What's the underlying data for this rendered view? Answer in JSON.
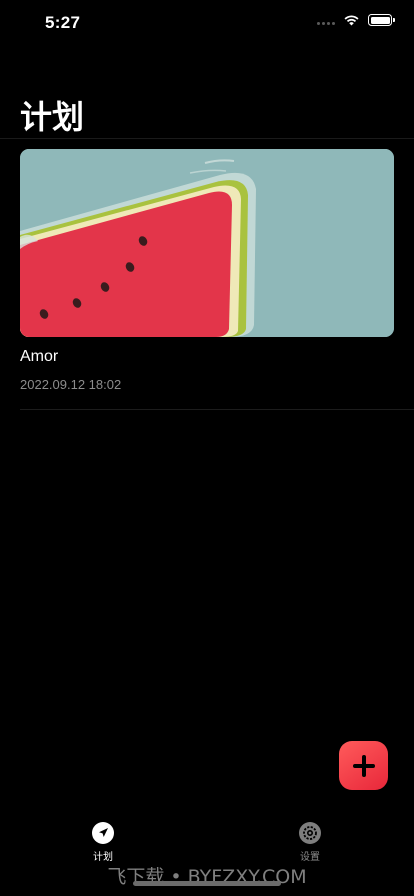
{
  "status_bar": {
    "time": "5:27"
  },
  "header": {
    "title": "计划"
  },
  "plans": [
    {
      "title": "Amor",
      "date": "2022.09.12 18:02",
      "image": "watermelon-illustration"
    }
  ],
  "add_button": {
    "icon": "plus-icon"
  },
  "tab_bar": {
    "items": [
      {
        "label": "计划",
        "icon": "navigation-arrow-icon",
        "active": true
      },
      {
        "label": "设置",
        "icon": "gear-icon",
        "active": false
      }
    ]
  },
  "watermark": "飞下载 • BYFZXY.COM",
  "colors": {
    "accent": "#ff3b47",
    "background": "#000000",
    "card_bg": "#8fb8b9"
  }
}
